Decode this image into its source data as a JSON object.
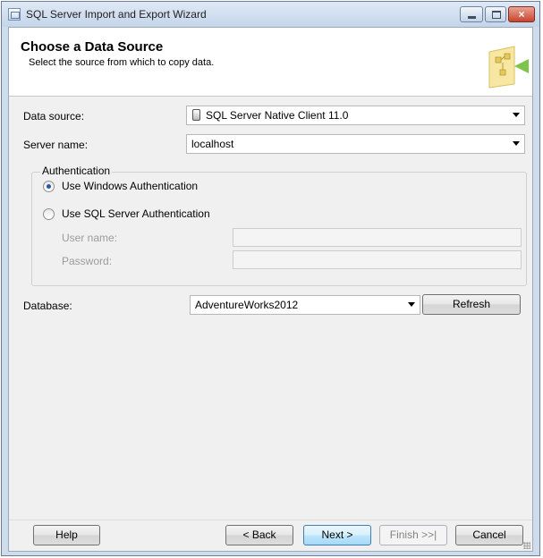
{
  "window": {
    "title": "SQL Server Import and Export Wizard",
    "close_glyph": "×"
  },
  "header": {
    "title": "Choose a Data Source",
    "subtitle": "Select the source from which to copy data."
  },
  "form": {
    "data_source_label": "Data source:",
    "data_source_value": "SQL Server Native Client 11.0",
    "server_name_label": "Server name:",
    "server_name_value": "localhost",
    "auth_group_label": "Authentication",
    "auth_windows_label": "Use Windows Authentication",
    "auth_sql_label": "Use SQL Server Authentication",
    "auth_selected": "windows",
    "user_name_label": "User name:",
    "user_name_value": "",
    "password_label": "Password:",
    "password_value": "",
    "database_label": "Database:",
    "database_value": "AdventureWorks2012",
    "refresh_label": "Refresh"
  },
  "footer": {
    "help": "Help",
    "back": "< Back",
    "next": "Next >",
    "finish": "Finish >>|",
    "cancel": "Cancel"
  }
}
